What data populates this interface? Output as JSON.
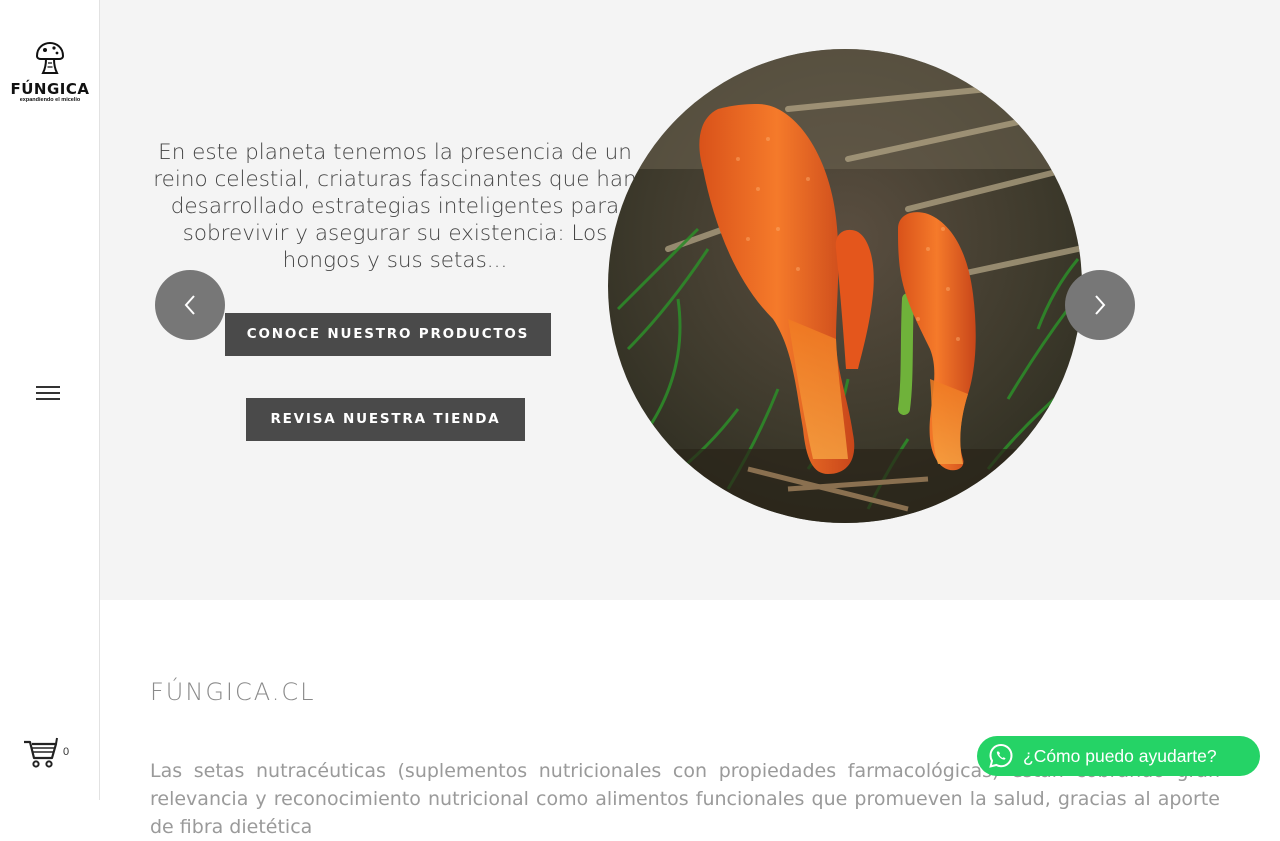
{
  "brand": {
    "name": "FÚNGICA",
    "tagline": "expandiendo el micelio"
  },
  "hero": {
    "text": "En este planeta tenemos la presencia de un reino celestial, criaturas fascinantes que han desarrollado estrategias inteligentes para sobrevivir y asegurar su existencia: Los hongos y sus setas...",
    "btn_products": "CONOCE NUESTRO PRODUCTOS",
    "btn_store": "REVISA NUESTRA TIENDA",
    "image_icon": "cordyceps-mushroom-image"
  },
  "cart": {
    "count": "0",
    "icon": "cart-icon"
  },
  "section": {
    "title": "FÚNGICA.CL",
    "paragraph": "Las setas nutracéuticas (suplementos nutricionales con propiedades farmacológicas) están cobrando gran relevancia y reconocimiento nutricional como alimentos funcionales que promueven la salud, gracias al aporte de fibra dietética"
  },
  "whatsapp": {
    "label": "¿Cómo puedo ayudarte?",
    "color": "#25d366",
    "icon": "whatsapp-icon"
  },
  "colors": {
    "hero_bg": "#f4f4f4",
    "button_bg": "#4a4a4a",
    "arrow_bg": "#777777"
  }
}
